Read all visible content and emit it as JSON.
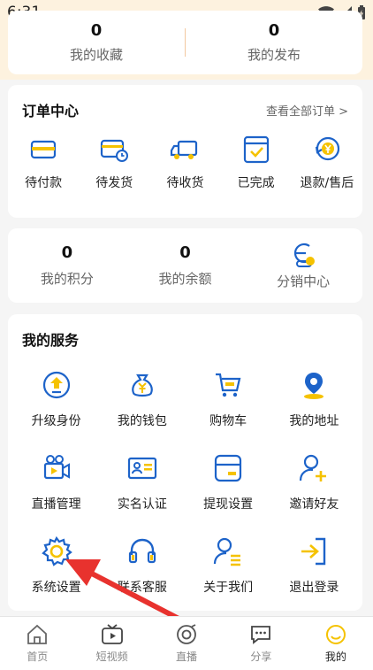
{
  "status": {
    "time": "6:31"
  },
  "top_stats": [
    {
      "value": "0",
      "label": "我的收藏"
    },
    {
      "value": "0",
      "label": "我的发布"
    }
  ],
  "orders": {
    "title": "订单中心",
    "view_all": "查看全部订单 >",
    "items": [
      {
        "label": "待付款",
        "icon": "wallet-card-icon"
      },
      {
        "label": "待发货",
        "icon": "card-clock-icon"
      },
      {
        "label": "待收货",
        "icon": "truck-icon"
      },
      {
        "label": "已完成",
        "icon": "check-card-icon"
      },
      {
        "label": "退款/售后",
        "icon": "refund-yen-icon"
      }
    ]
  },
  "wallet_stats": [
    {
      "value": "0",
      "label": "我的积分"
    },
    {
      "value": "0",
      "label": "我的余额"
    },
    {
      "value": "",
      "label": "分销中心"
    }
  ],
  "services": {
    "title": "我的服务",
    "items": [
      {
        "label": "升级身份",
        "icon": "upgrade-icon"
      },
      {
        "label": "我的钱包",
        "icon": "money-bag-icon"
      },
      {
        "label": "购物车",
        "icon": "cart-icon"
      },
      {
        "label": "我的地址",
        "icon": "location-pin-icon"
      },
      {
        "label": "直播管理",
        "icon": "video-camera-icon"
      },
      {
        "label": "实名认证",
        "icon": "id-card-icon"
      },
      {
        "label": "提现设置",
        "icon": "withdraw-card-icon"
      },
      {
        "label": "邀请好友",
        "icon": "invite-user-icon"
      },
      {
        "label": "系统设置",
        "icon": "gear-icon"
      },
      {
        "label": "联系客服",
        "icon": "headset-icon"
      },
      {
        "label": "关于我们",
        "icon": "about-user-icon"
      },
      {
        "label": "退出登录",
        "icon": "logout-icon"
      }
    ]
  },
  "tabs": [
    {
      "label": "首页",
      "icon": "home-icon"
    },
    {
      "label": "短视频",
      "icon": "play-tv-icon"
    },
    {
      "label": "直播",
      "icon": "live-record-icon"
    },
    {
      "label": "分享",
      "icon": "chat-share-icon"
    },
    {
      "label": "我的",
      "icon": "smile-profile-icon",
      "active": true
    }
  ],
  "colors": {
    "accent_blue": "#1d63c9",
    "accent_yellow": "#f5c200",
    "tab_active": "#f5c200",
    "arrow_red": "#e8322e"
  }
}
